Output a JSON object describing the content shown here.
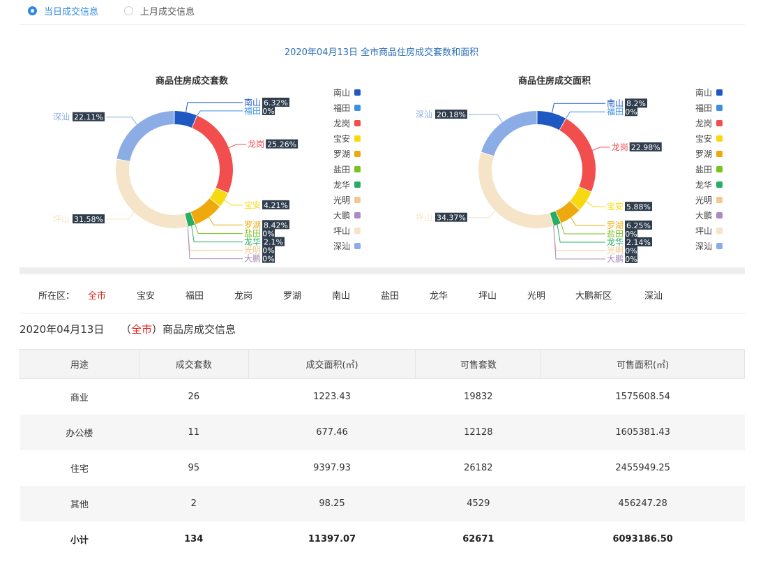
{
  "radio": {
    "options": [
      {
        "label": "当日成交信息",
        "checked": true
      },
      {
        "label": "上月成交信息",
        "checked": false
      }
    ]
  },
  "chart_heading": "2020年04月13日 全市商品住房成交套数和面积",
  "chart_data": [
    {
      "type": "pie",
      "variant": "donut",
      "title": "商品住房成交套数",
      "categories": [
        "南山",
        "福田",
        "龙岗",
        "宝安",
        "罗湖",
        "盐田",
        "龙华",
        "光明",
        "大鹏",
        "坪山",
        "深汕"
      ],
      "values": [
        6.32,
        0,
        25.26,
        4.21,
        8.42,
        0,
        2.1,
        0,
        0,
        31.58,
        22.11
      ],
      "unit": "%",
      "colors": [
        "#1f57c3",
        "#3a8fe6",
        "#f24e4e",
        "#f7d90f",
        "#eeaa0c",
        "#7ac21f",
        "#28ad64",
        "#f4c78e",
        "#a98ac2",
        "#f5e4c8",
        "#8cace6"
      ],
      "legend": "right"
    },
    {
      "type": "pie",
      "variant": "donut",
      "title": "商品住房成交面积",
      "categories": [
        "南山",
        "福田",
        "龙岗",
        "宝安",
        "罗湖",
        "盐田",
        "龙华",
        "光明",
        "大鹏",
        "坪山",
        "深汕"
      ],
      "values": [
        8.2,
        0,
        22.98,
        5.88,
        6.25,
        0,
        2.14,
        0,
        0,
        34.37,
        20.18
      ],
      "unit": "%",
      "colors": [
        "#1f57c3",
        "#3a8fe6",
        "#f24e4e",
        "#f7d90f",
        "#eeaa0c",
        "#7ac21f",
        "#28ad64",
        "#f4c78e",
        "#a98ac2",
        "#f5e4c8",
        "#8cace6"
      ],
      "legend": "right"
    }
  ],
  "district_filter": {
    "label": "所在区：",
    "items": [
      "全市",
      "宝安",
      "福田",
      "龙岗",
      "罗湖",
      "南山",
      "盐田",
      "龙华",
      "坪山",
      "光明",
      "大鹏新区",
      "深汕"
    ],
    "active": "全市"
  },
  "info_heading": {
    "date": "2020年04月13日",
    "open_paren": "（",
    "district": "全市",
    "close_paren": "）",
    "suffix": "商品房成交信息"
  },
  "table": {
    "columns": [
      "用途",
      "成交套数",
      "成交面积(㎡)",
      "可售套数",
      "可售面积(㎡)"
    ],
    "rows": [
      [
        "商业",
        "26",
        "1223.43",
        "19832",
        "1575608.54"
      ],
      [
        "办公楼",
        "11",
        "677.46",
        "12128",
        "1605381.43"
      ],
      [
        "住宅",
        "95",
        "9397.93",
        "26182",
        "2455949.25"
      ],
      [
        "其他",
        "2",
        "98.25",
        "4529",
        "456247.28"
      ]
    ],
    "total": [
      "小计",
      "134",
      "11397.07",
      "62671",
      "6093186.50"
    ]
  }
}
